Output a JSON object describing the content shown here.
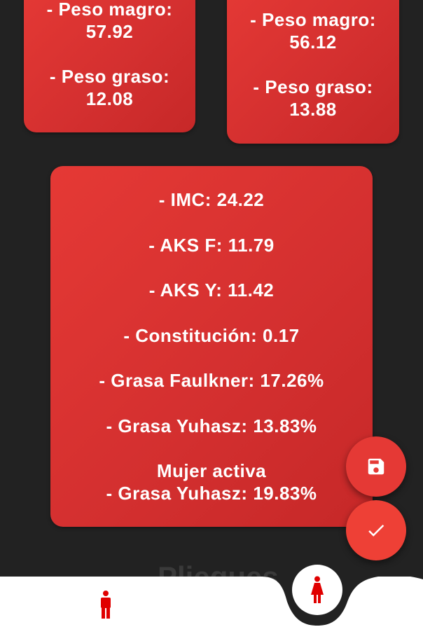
{
  "cards": {
    "left": {
      "lines": [
        "- Peso magro:",
        "57.92",
        "- Peso graso:",
        "12.08"
      ]
    },
    "right": {
      "lines": [
        "- Peso magro:",
        "56.12",
        "- Peso graso:",
        "13.88"
      ]
    },
    "main": {
      "rows": [
        "- IMC: 24.22",
        "- AKS F: 11.79",
        "- AKS Y: 11.42",
        "- Constitución: 0.17",
        "- Grasa Faulkner: 17.26%",
        "- Grasa Yuhasz: 13.83%",
        "Mujer activa",
        "- Grasa Yuhasz: 19.83%"
      ]
    }
  },
  "ghost_title": "Pliegues",
  "fab": {
    "save_icon": "floppy-disk-icon",
    "check_icon": "check-icon"
  },
  "bottom_nav": {
    "items": [
      {
        "icon": "male-icon",
        "selected": false
      },
      {
        "icon": "female-icon",
        "selected": true
      }
    ]
  },
  "colors": {
    "background": "#222222",
    "card": "#e53935",
    "accent": "#e00000",
    "nav": "#ffffff"
  }
}
